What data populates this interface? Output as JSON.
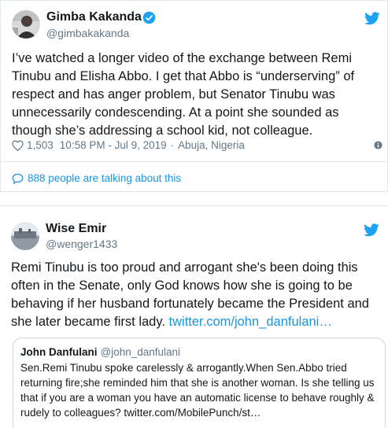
{
  "tweet1": {
    "name": "Gimba Kakanda",
    "handle": "@gimbakakanda",
    "text": "I’ve watched a longer video of the exchange between Remi Tinubu and Elisha Abbo. I get that Abbo is “underserving” of respect and has anger problem, but Senator Tinubu was unnecessarily condescending. At a point she sounded as though she’s addressing a school kid, not colleague.",
    "likes": "1,503",
    "time": "10:58 PM - Jul 9, 2019",
    "location": "Abuja, Nigeria",
    "talking": "888 people are talking about this"
  },
  "tweet2": {
    "name": "Wise Emir",
    "handle": "@wenger1433",
    "text": "Remi Tinubu is too proud and arrogant she's been doing this often in the Senate, only God knows how she is going to be behaving if her husband fortunately became the President and she later became first lady. ",
    "link": "twitter.com/john_danfulani…",
    "quote": {
      "name": "John Danfulani",
      "handle": "@john_danfulani",
      "text": "Sen.Remi Tinubu spoke carelessly & arrogantly.When Sen.Abbo tried returning fire;she reminded him that she is another woman. Is she telling us that if you are a woman you have an automatic license to behave roughly & rudely to colleagues? twitter.com/MobilePunch/st…"
    }
  },
  "colors": {
    "accent": "#1da1f2",
    "link": "#1b95e0",
    "muted": "#657786",
    "border": "#e1e8ed"
  },
  "icons": {
    "verified": "verified-badge-icon",
    "bird": "twitter-bird-icon",
    "heart": "heart-icon",
    "info": "info-icon",
    "bubble": "speech-bubble-icon"
  }
}
